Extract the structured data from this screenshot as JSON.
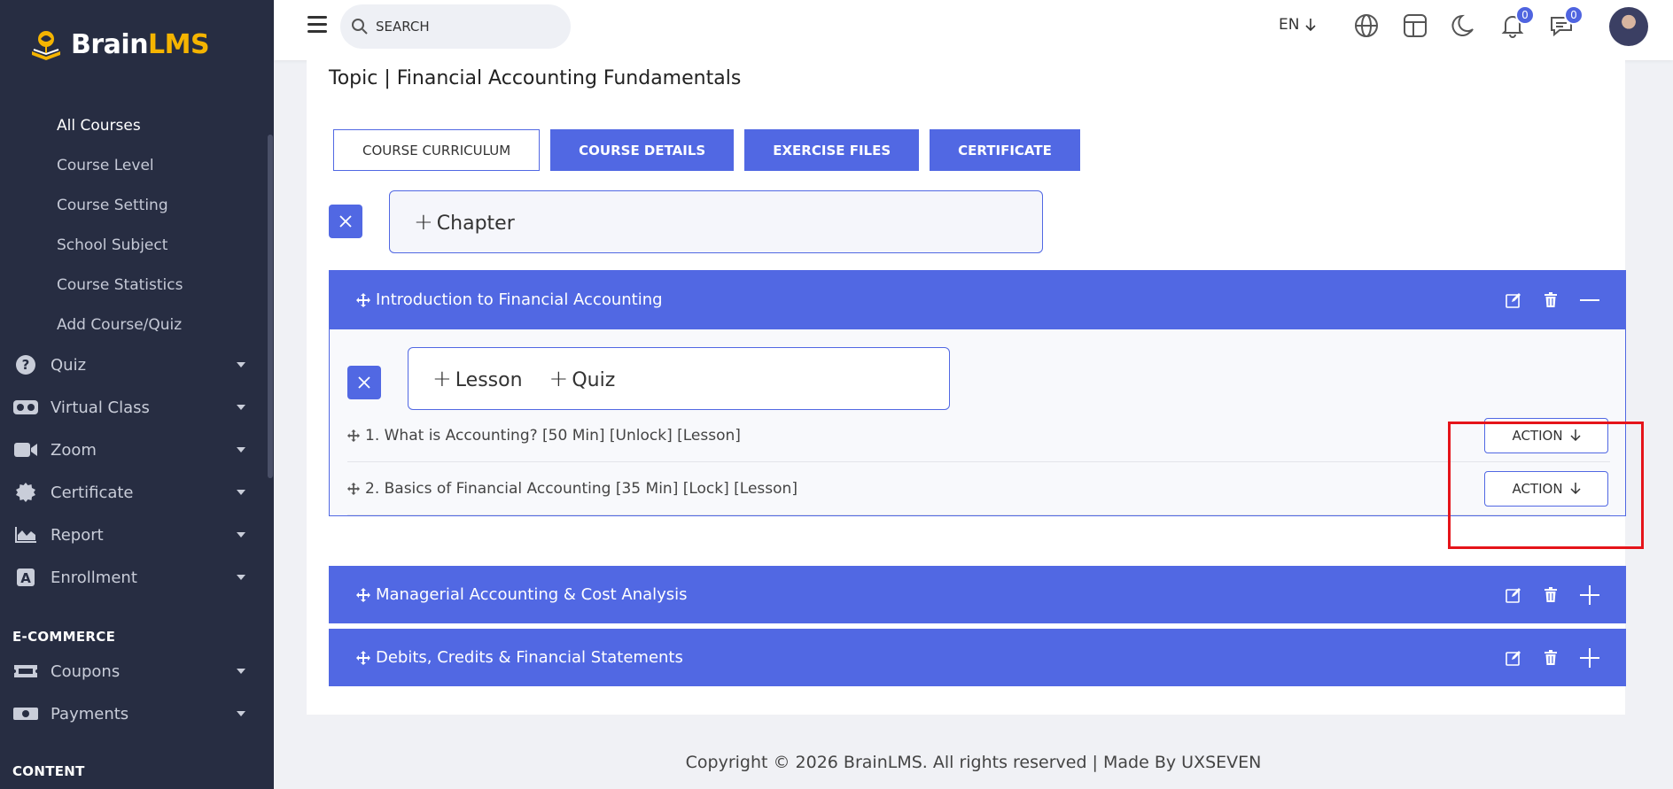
{
  "app": {
    "logo_brain": "Brain",
    "logo_lms": "LMS"
  },
  "sidebar": {
    "sub_items": [
      {
        "label": "All Courses",
        "active": true
      },
      {
        "label": "Course Level"
      },
      {
        "label": "Course Setting"
      },
      {
        "label": "School Subject"
      },
      {
        "label": "Course Statistics"
      },
      {
        "label": "Add Course/Quiz"
      }
    ],
    "menu": [
      {
        "label": "Quiz",
        "icon": "question-circle-icon"
      },
      {
        "label": "Virtual Class",
        "icon": "vr-headset-icon"
      },
      {
        "label": "Zoom",
        "icon": "video-camera-icon"
      },
      {
        "label": "Certificate",
        "icon": "certificate-badge-icon"
      },
      {
        "label": "Report",
        "icon": "area-chart-icon"
      },
      {
        "label": "Enrollment",
        "icon": "enrollment-a-icon"
      }
    ],
    "ecommerce_title": "E-COMMERCE",
    "ecommerce": [
      {
        "label": "Coupons",
        "icon": "ticket-icon"
      },
      {
        "label": "Payments",
        "icon": "money-icon"
      }
    ],
    "content_title": "CONTENT"
  },
  "header": {
    "search_placeholder": "SEARCH",
    "lang": "EN",
    "notifications_count": "0",
    "messages_count": "0"
  },
  "page": {
    "topic_title": "Topic | Financial Accounting Fundamentals",
    "tabs": [
      "COURSE CURRICULUM",
      "COURSE DETAILS",
      "EXERCISE FILES",
      "CERTIFICATE"
    ],
    "add_chapter": "Chapter",
    "chapters": [
      {
        "title": "Introduction to Financial Accounting",
        "expanded": true,
        "add_lesson": "Lesson",
        "add_quiz": "Quiz",
        "lessons": [
          {
            "label": "1. What is Accounting? [50 Min] [Unlock] [Lesson]",
            "action": "ACTION"
          },
          {
            "label": "2. Basics of Financial Accounting [35 Min] [Lock] [Lesson]",
            "action": "ACTION"
          }
        ]
      },
      {
        "title": "Managerial Accounting & Cost Analysis",
        "expanded": false
      },
      {
        "title": "Debits, Credits & Financial Statements",
        "expanded": false
      }
    ]
  },
  "footer": {
    "text": "Copyright © 2026 BrainLMS. All rights reserved | Made By UXSEVEN"
  },
  "colors": {
    "primary": "#5168e3",
    "sidebar": "#272d42",
    "accent": "#f5b400",
    "highlight": "#e5141a"
  }
}
